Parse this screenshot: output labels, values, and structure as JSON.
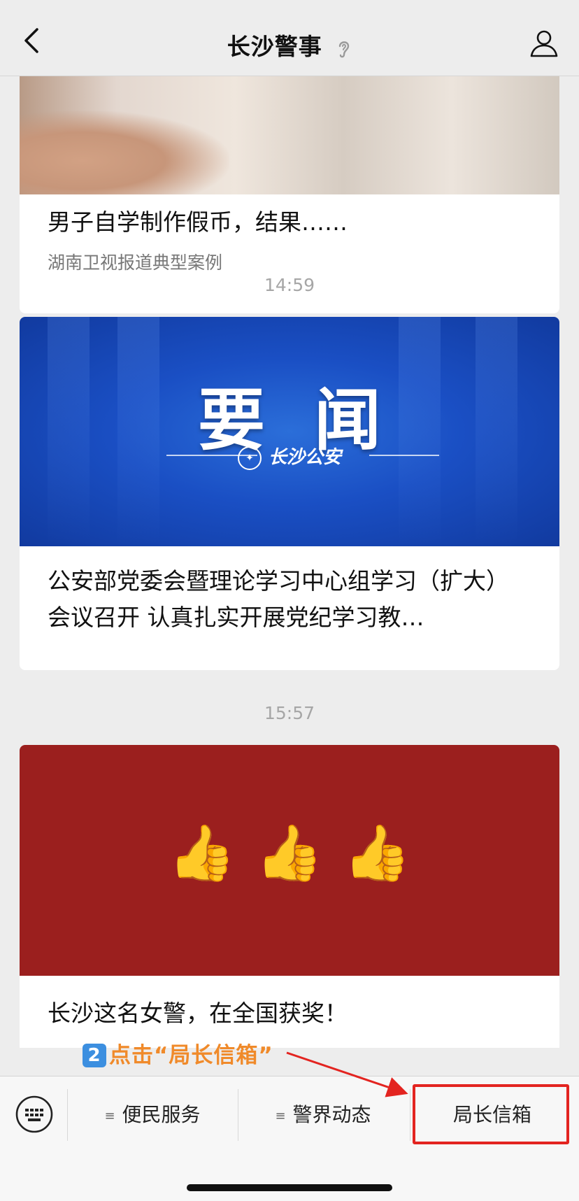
{
  "header": {
    "title": "长沙警事"
  },
  "feed": [
    {
      "title": "男子自学制作假币，结果……",
      "subtitle": "湖南卫视报道典型案例"
    },
    {
      "time": "14:59",
      "banner_headline": "要闻",
      "banner_org": "长沙公安",
      "title": "公安部党委会暨理论学习中心组学习（扩大）会议召开 认真扎实开展党纪学习教…"
    },
    {
      "time": "15:57",
      "banner_emoji": "👍👍👍",
      "title": "长沙这名女警，在全国获奖！"
    }
  ],
  "annotation": {
    "step": "2",
    "text": "点击“局长信箱”"
  },
  "menu": {
    "items": [
      {
        "label": "便民服务",
        "has_submenu": true
      },
      {
        "label": "警界动态",
        "has_submenu": true
      },
      {
        "label": "局长信箱",
        "has_submenu": false
      }
    ],
    "submenu_glyph": "≡"
  },
  "colors": {
    "highlight": "#e32420",
    "annotation": "#f08a2a",
    "banner_blue": "#1a4fc4",
    "banner_red": "#9b1f1e"
  }
}
